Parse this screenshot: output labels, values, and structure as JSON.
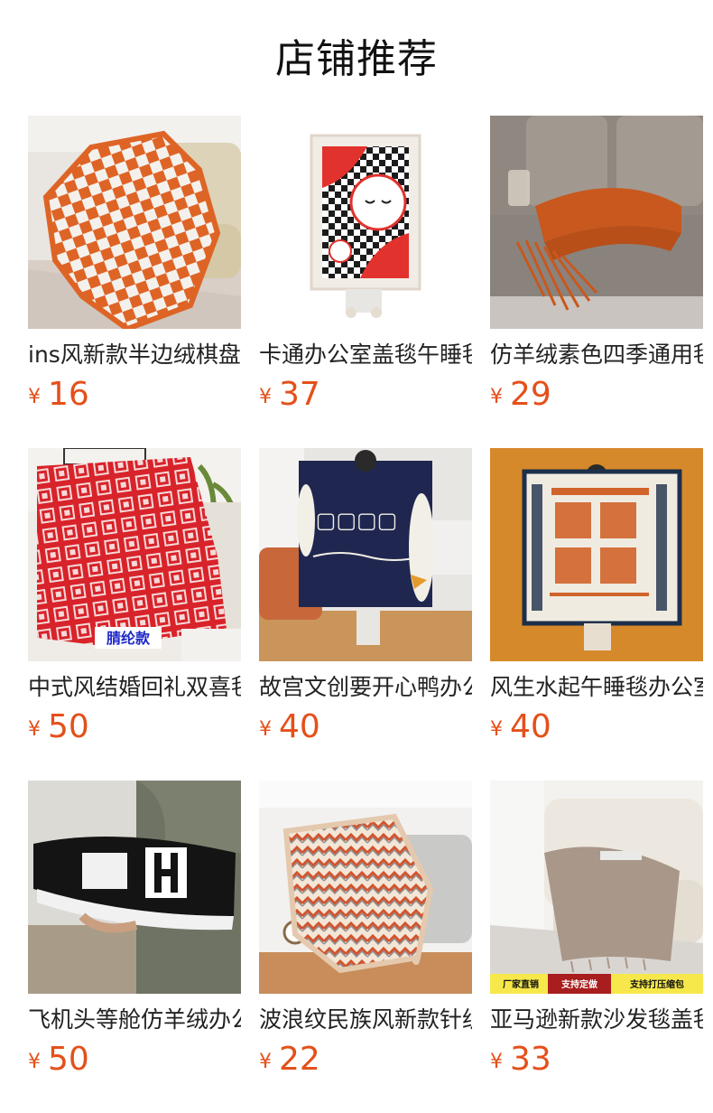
{
  "section": {
    "title": "店铺推荐"
  },
  "products": [
    {
      "name": "ins风新款半边绒棋盘格毯",
      "currency": "¥",
      "price": "16",
      "image_icon": "checkered-blanket-photo"
    },
    {
      "name": "卡通办公室盖毯午睡毯",
      "currency": "¥",
      "price": "37",
      "image_icon": "cartoon-blanket-photo"
    },
    {
      "name": "仿羊绒素色四季通用毯",
      "currency": "¥",
      "price": "29",
      "image_icon": "rust-throw-photo"
    },
    {
      "name": "中式风结婚回礼双喜毯",
      "currency": "¥",
      "price": "50",
      "image_icon": "red-double-happiness-blanket-photo",
      "badge": "腈纶款"
    },
    {
      "name": "故宫文创要开心鸭办公毯",
      "currency": "¥",
      "price": "40",
      "image_icon": "happy-duck-blanket-photo"
    },
    {
      "name": "风生水起午睡毯办公室毯",
      "currency": "¥",
      "price": "40",
      "image_icon": "best-lucky-blanket-photo"
    },
    {
      "name": "飞机头等舱仿羊绒办公毯",
      "currency": "¥",
      "price": "50",
      "image_icon": "h-pattern-blanket-photo"
    },
    {
      "name": "波浪纹民族风新款针织毯",
      "currency": "¥",
      "price": "22",
      "image_icon": "zigzag-blanket-photo"
    },
    {
      "name": "亚马逊新款沙发毯盖毯",
      "currency": "¥",
      "price": "33",
      "image_icon": "beige-sofa-throw-photo",
      "banner": [
        "厂家直销",
        "支持定做",
        "支持打压缩包"
      ]
    }
  ],
  "colors": {
    "price": "#e4501a"
  }
}
